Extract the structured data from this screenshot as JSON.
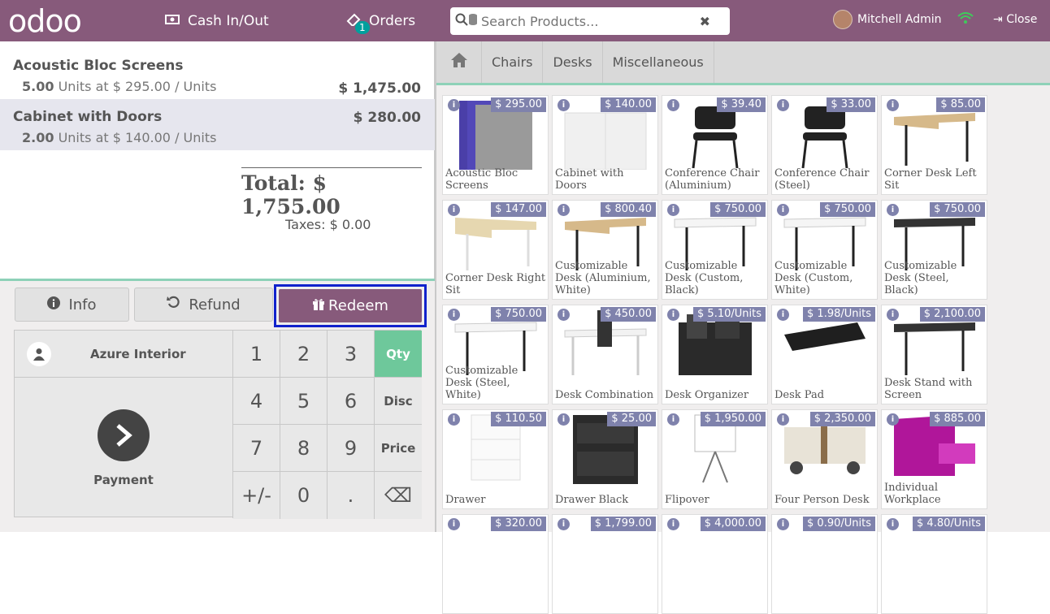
{
  "header": {
    "logo": "odoo",
    "cash_label": "Cash In/Out",
    "orders_label": "Orders",
    "orders_count": "1",
    "search_placeholder": "Search Products...",
    "user_name": "Mitchell Admin",
    "close_label": "Close"
  },
  "order": {
    "lines": [
      {
        "name": "Acoustic Bloc Screens",
        "qty": "5.00",
        "detail": "Units at $ 295.00 / Units",
        "price": "$ 1,475.00"
      },
      {
        "name": "Cabinet with Doors",
        "qty": "2.00",
        "detail": "Units at $ 140.00 / Units",
        "price": "$ 280.00"
      }
    ],
    "total": "Total: $ 1,755.00",
    "taxes": "Taxes: $ 0.00"
  },
  "controls": {
    "info": "Info",
    "refund": "Refund",
    "redeem": "Redeem",
    "customer": "Azure Interior",
    "payment": "Payment",
    "keys": [
      "1",
      "2",
      "3",
      "Qty",
      "4",
      "5",
      "6",
      "Disc",
      "7",
      "8",
      "9",
      "Price",
      "+/-",
      "0",
      ".",
      "⌫"
    ]
  },
  "categories": [
    "Chairs",
    "Desks",
    "Miscellaneous"
  ],
  "products": [
    {
      "name": "Acoustic Bloc Screens",
      "price": "$ 295.00",
      "kind": "screen"
    },
    {
      "name": "Cabinet with Doors",
      "price": "$ 140.00",
      "kind": "cabinet"
    },
    {
      "name": "Conference Chair (Aluminium)",
      "price": "$ 39.40",
      "kind": "chair"
    },
    {
      "name": "Conference Chair (Steel)",
      "price": "$ 33.00",
      "kind": "chair"
    },
    {
      "name": "Corner Desk Left Sit",
      "price": "$ 85.00",
      "kind": "desk-wood"
    },
    {
      "name": "Corner Desk Right Sit",
      "price": "$ 147.00",
      "kind": "desk-wood-white"
    },
    {
      "name": "Customizable Desk (Aluminium, White)",
      "price": "$ 800.40",
      "kind": "desk-wood"
    },
    {
      "name": "Customizable Desk (Custom, Black)",
      "price": "$ 750.00",
      "kind": "desk-white"
    },
    {
      "name": "Customizable Desk (Custom, White)",
      "price": "$ 750.00",
      "kind": "desk-white"
    },
    {
      "name": "Customizable Desk (Steel, Black)",
      "price": "$ 750.00",
      "kind": "desk-black"
    },
    {
      "name": "Customizable Desk (Steel, White)",
      "price": "$ 750.00",
      "kind": "desk-white"
    },
    {
      "name": "Desk Combination",
      "price": "$ 450.00",
      "kind": "combo"
    },
    {
      "name": "Desk Organizer",
      "price": "$ 5.10/Units",
      "kind": "organizer"
    },
    {
      "name": "Desk Pad",
      "price": "$ 1.98/Units",
      "kind": "pad"
    },
    {
      "name": "Desk Stand with Screen",
      "price": "$ 2,100.00",
      "kind": "desk-black"
    },
    {
      "name": "Drawer",
      "price": "$ 110.50",
      "kind": "drawer"
    },
    {
      "name": "Drawer Black",
      "price": "$ 25.00",
      "kind": "drawer-black"
    },
    {
      "name": "Flipover",
      "price": "$ 1,950.00",
      "kind": "flip"
    },
    {
      "name": "Four Person Desk",
      "price": "$ 2,350.00",
      "kind": "four"
    },
    {
      "name": "Individual Workplace",
      "price": "$ 885.00",
      "kind": "pink"
    },
    {
      "name": "",
      "price": "$ 320.00",
      "kind": "none"
    },
    {
      "name": "",
      "price": "$ 1,799.00",
      "kind": "none"
    },
    {
      "name": "",
      "price": "$ 4,000.00",
      "kind": "none"
    },
    {
      "name": "",
      "price": "$ 0.90/Units",
      "kind": "none"
    },
    {
      "name": "",
      "price": "$ 4.80/Units",
      "kind": "none"
    }
  ]
}
